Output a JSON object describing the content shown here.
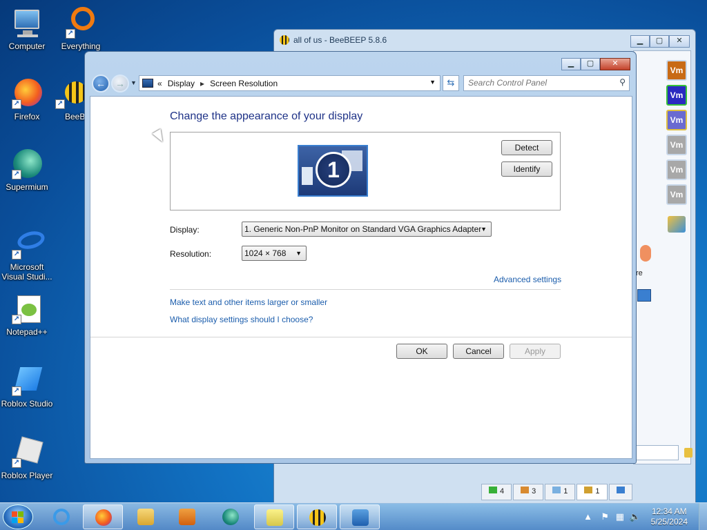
{
  "desktop": {
    "icons": [
      {
        "label": "Computer"
      },
      {
        "label": "Everything"
      },
      {
        "label": "Firefox"
      },
      {
        "label": "BeeB"
      },
      {
        "label": "Supermium"
      },
      {
        "label": "Microsoft Visual Studi..."
      },
      {
        "label": "Notepad++"
      },
      {
        "label": "Roblox Studio"
      },
      {
        "label": "Roblox Player"
      }
    ]
  },
  "beebeep": {
    "title": "all of us - BeeBEEP 5.8.6",
    "vm_label": "Vm",
    "side_text": "re",
    "status_tabs": [
      "4",
      "3",
      "1",
      "1"
    ]
  },
  "window": {
    "breadcrumb": {
      "root": "«",
      "item1": "Display",
      "item2": "Screen Resolution"
    },
    "search_placeholder": "Search Control Panel",
    "heading": "Change the appearance of your display",
    "monitor_number": "1",
    "detect_label": "Detect",
    "identify_label": "Identify",
    "display_label": "Display:",
    "display_value": "1. Generic Non-PnP Monitor on Standard VGA Graphics Adapter",
    "resolution_label": "Resolution:",
    "resolution_value": "1024 × 768",
    "advanced_link": "Advanced settings",
    "link_text_size": "Make text and other items larger or smaller",
    "link_settings_help": "What display settings should I choose?",
    "ok_label": "OK",
    "cancel_label": "Cancel",
    "apply_label": "Apply"
  },
  "taskbar": {
    "time": "12:34 AM",
    "date": "5/25/2024"
  },
  "colors": {
    "accent_link": "#1b5dac",
    "heading": "#1e3287",
    "close_button": "#c4422b"
  }
}
